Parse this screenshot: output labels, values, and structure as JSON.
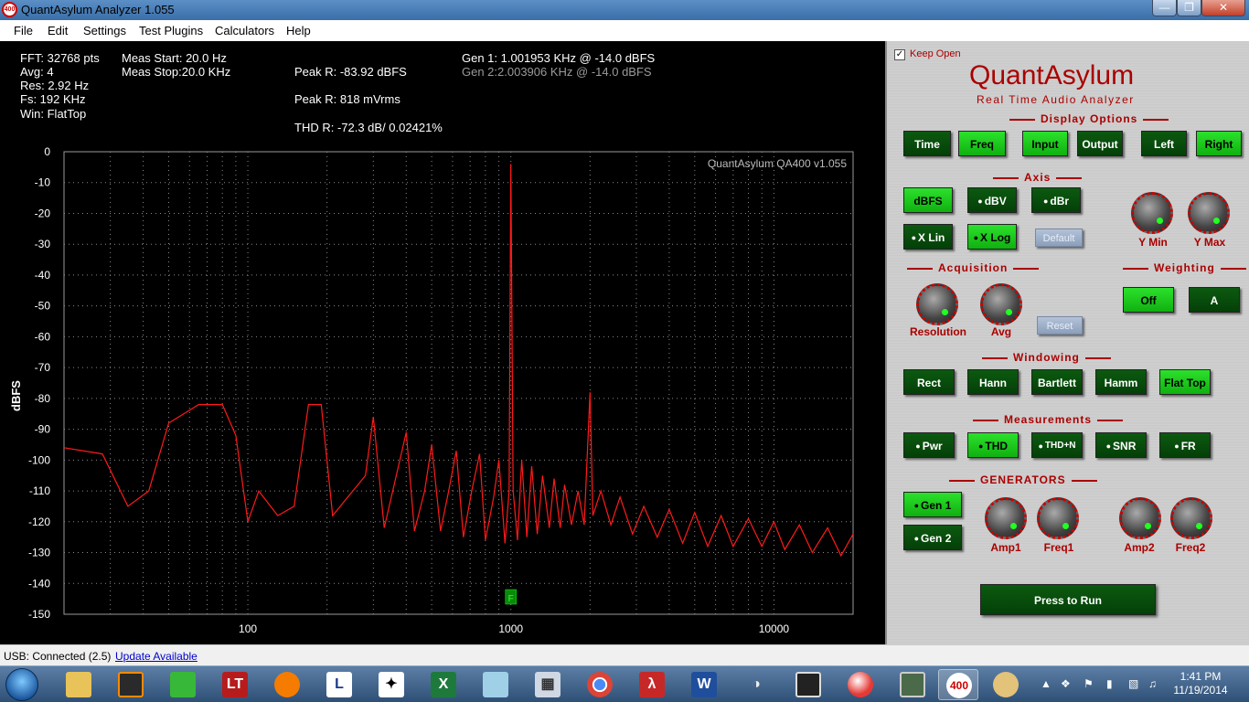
{
  "window": {
    "title": "QuantAsylum Analyzer 1.055",
    "icon_text": "400"
  },
  "menu": [
    "File",
    "Edit",
    "Settings",
    "Test Plugins",
    "Calculators",
    "Help"
  ],
  "stats": {
    "fft": "FFT: 32768 pts",
    "avg": "Avg: 4",
    "res": "Res: 2.92 Hz",
    "fs": "Fs: 192 KHz",
    "win": "Win: FlatTop",
    "meas_start": "Meas Start: 20.0 Hz",
    "meas_stop": "Meas Stop:20.0 KHz",
    "peak_dbfs": "Peak R: -83.92 dBFS",
    "peak_mvrms": "Peak R: 818 mVrms",
    "thd": "THD R: -72.3 dB/ 0.02421%",
    "gen1": "Gen 1: 1.001953 KHz @ -14.0  dBFS",
    "gen2": "Gen 2:2.003906 KHz @ -14.0  dBFS"
  },
  "chart_data": {
    "type": "line",
    "watermark": "QuantAsylum QA400 v1.055",
    "ylabel": "dBFS",
    "xscale": "log",
    "xlim": [
      20,
      20000
    ],
    "ylim": [
      -150,
      0
    ],
    "yticks": [
      0,
      -10,
      -20,
      -30,
      -40,
      -50,
      -60,
      -70,
      -80,
      -90,
      -100,
      -110,
      -120,
      -130,
      -140,
      -150
    ],
    "xticks": [
      100,
      1000,
      10000
    ],
    "marker_label": "F",
    "series": [
      {
        "color": "#ff1a1a",
        "points": [
          [
            20,
            -96
          ],
          [
            28,
            -98
          ],
          [
            35,
            -115
          ],
          [
            42,
            -110
          ],
          [
            50,
            -88
          ],
          [
            65,
            -82
          ],
          [
            80,
            -82
          ],
          [
            90,
            -92
          ],
          [
            100,
            -120
          ],
          [
            110,
            -110
          ],
          [
            130,
            -118
          ],
          [
            150,
            -115
          ],
          [
            170,
            -82
          ],
          [
            190,
            -82
          ],
          [
            210,
            -118
          ],
          [
            240,
            -112
          ],
          [
            280,
            -105
          ],
          [
            300,
            -86
          ],
          [
            330,
            -122
          ],
          [
            360,
            -108
          ],
          [
            400,
            -91
          ],
          [
            430,
            -123
          ],
          [
            470,
            -110
          ],
          [
            500,
            -95
          ],
          [
            540,
            -123
          ],
          [
            580,
            -110
          ],
          [
            620,
            -97
          ],
          [
            660,
            -125
          ],
          [
            710,
            -110
          ],
          [
            760,
            -98
          ],
          [
            800,
            -126
          ],
          [
            860,
            -112
          ],
          [
            900,
            -100
          ],
          [
            950,
            -127
          ],
          [
            985,
            -110
          ],
          [
            1000,
            -4
          ],
          [
            1020,
            -110
          ],
          [
            1060,
            -126
          ],
          [
            1100,
            -100
          ],
          [
            1150,
            -125
          ],
          [
            1200,
            -102
          ],
          [
            1260,
            -124
          ],
          [
            1320,
            -105
          ],
          [
            1400,
            -122
          ],
          [
            1460,
            -106
          ],
          [
            1540,
            -122
          ],
          [
            1600,
            -108
          ],
          [
            1700,
            -121
          ],
          [
            1800,
            -110
          ],
          [
            1900,
            -121
          ],
          [
            2000,
            -78
          ],
          [
            2050,
            -118
          ],
          [
            2200,
            -110
          ],
          [
            2400,
            -121
          ],
          [
            2600,
            -112
          ],
          [
            2900,
            -124
          ],
          [
            3200,
            -115
          ],
          [
            3600,
            -125
          ],
          [
            4000,
            -116
          ],
          [
            4500,
            -127
          ],
          [
            5000,
            -117
          ],
          [
            5600,
            -128
          ],
          [
            6300,
            -118
          ],
          [
            7000,
            -128
          ],
          [
            8000,
            -119
          ],
          [
            9000,
            -128
          ],
          [
            10000,
            -120
          ],
          [
            11000,
            -129
          ],
          [
            12500,
            -121
          ],
          [
            14000,
            -130
          ],
          [
            16000,
            -122
          ],
          [
            18000,
            -131
          ],
          [
            20000,
            -124
          ]
        ]
      }
    ]
  },
  "panel": {
    "keep_open": "Keep Open",
    "brand": "QuantAsylum",
    "brand_sub": "Real Time Audio Analyzer",
    "display_options": "Display Options",
    "display_buttons": [
      "Time",
      "Freq",
      "Input",
      "Output",
      "Left",
      "Right"
    ],
    "axis": "Axis",
    "axis_buttons": [
      "dBFS",
      "dBV",
      "dBr",
      "X Lin",
      "X Log"
    ],
    "default_btn": "Default",
    "ymin": "Y Min",
    "ymax": "Y Max",
    "acquisition": "Acquisition",
    "resolution": "Resolution",
    "avg": "Avg",
    "reset_btn": "Reset",
    "weighting": "Weighting",
    "weight_buttons": [
      "Off",
      "A"
    ],
    "windowing": "Windowing",
    "window_buttons": [
      "Rect",
      "Hann",
      "Bartlett",
      "Hamm",
      "Flat Top"
    ],
    "measurements": "Measurements",
    "meas_buttons": [
      "Pwr",
      "THD",
      "THD+N",
      "SNR",
      "FR"
    ],
    "generators": "GENERATORS",
    "gen_buttons": [
      "Gen 1",
      "Gen 2"
    ],
    "amp1": "Amp1",
    "freq1": "Freq1",
    "amp2": "Amp2",
    "freq2": "Freq2",
    "run": "Press to Run"
  },
  "status": {
    "usb": "USB: Connected  (2.5)",
    "update": "Update Available"
  },
  "taskbar": {
    "time": "1:41 PM",
    "date": "11/19/2014"
  },
  "colors": {
    "accent_on": "#22d022",
    "accent_off": "#064a0a",
    "brand": "#aa0000",
    "trace": "#ff1a1a"
  }
}
